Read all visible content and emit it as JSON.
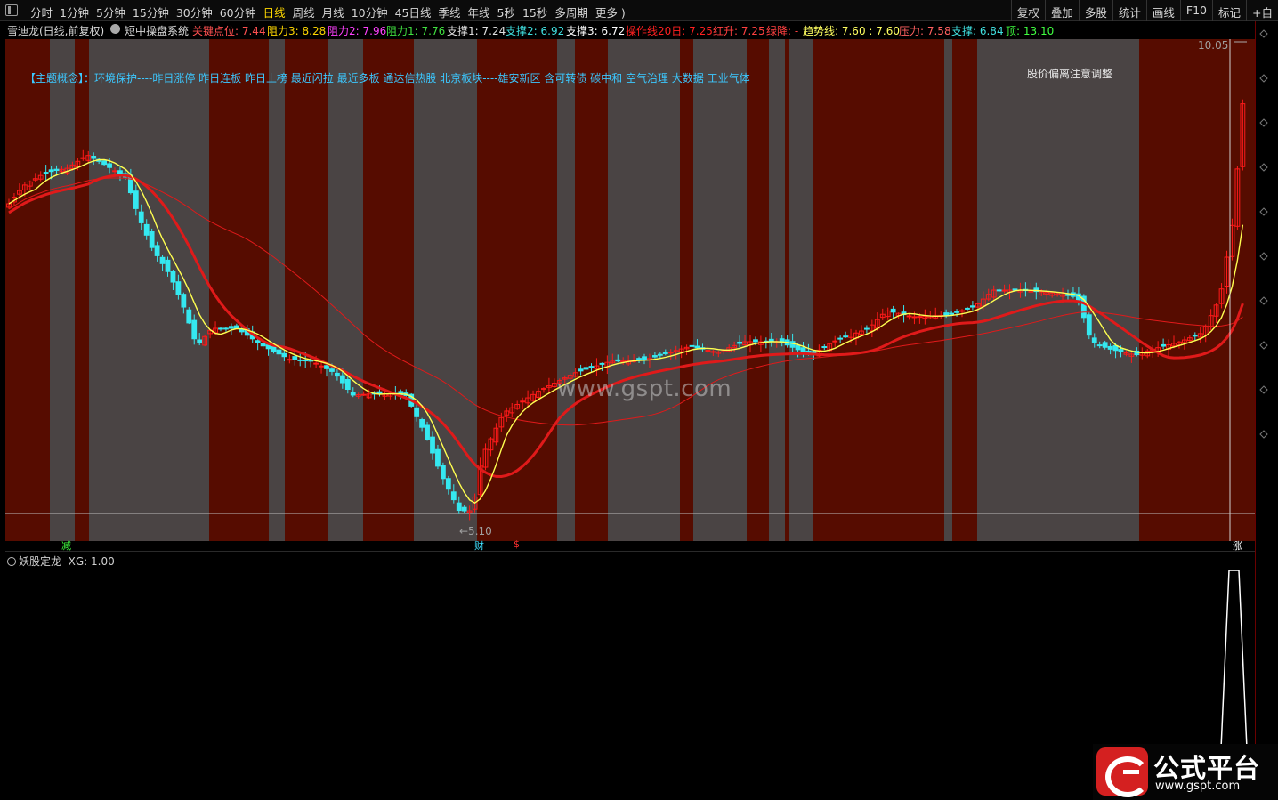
{
  "toolbar": {
    "periods": [
      "分时",
      "1分钟",
      "5分钟",
      "15分钟",
      "30分钟",
      "60分钟",
      "日线",
      "周线",
      "月线",
      "10分钟",
      "45日线",
      "季线",
      "年线",
      "5秒",
      "15秒",
      "多周期",
      "更多 )"
    ],
    "active_period": "日线",
    "right_tools": [
      "复权",
      "叠加",
      "多股",
      "统计",
      "画线",
      "F10",
      "标记",
      "+自"
    ]
  },
  "info_line": {
    "stock": "雪迪龙(日线,前复权)",
    "system": "短中操盘系统",
    "items": [
      {
        "label": "关键点位:",
        "value": "7.44",
        "color": "#ff5050"
      },
      {
        "label": "阻力3:",
        "value": "8.28",
        "color": "#ffd700"
      },
      {
        "label": "阻力2:",
        "value": "7.96",
        "color": "#ff40ff"
      },
      {
        "label": "阻力1:",
        "value": "7.76",
        "color": "#40e040"
      },
      {
        "label": "支撑1:",
        "value": "7.24",
        "color": "#e0e0e0"
      },
      {
        "label": "支撑2:",
        "value": "6.92",
        "color": "#40e0e0"
      },
      {
        "label": "支撑3:",
        "value": "6.72",
        "color": "#ffffff"
      },
      {
        "label": "操作线20日:",
        "value": "7.25",
        "color": "#ff2020"
      },
      {
        "label": "红升:",
        "value": "7.25",
        "color": "#ff4040"
      },
      {
        "label": "绿降:",
        "value": "-",
        "color": "#ff4040"
      },
      {
        "label": "趋势线:",
        "value": "7.60 : 7.60",
        "color": "#ffff60"
      },
      {
        "label": "压力:",
        "value": "7.58",
        "color": "#ff6060"
      },
      {
        "label": "支撑:",
        "value": "6.84",
        "color": "#40e0e0"
      },
      {
        "label": "顶:",
        "value": "13.10",
        "color": "#40ff40"
      }
    ]
  },
  "main": {
    "concept_text": "【主题概念】：环境保护----昨日涨停 昨日连板 昨日上榜 最近闪拉 最近多板 通达信热股 北京板块----雄安新区 含可转债 碳中和 空气治理 大数据 工业气体",
    "warning_text": "股价偏离注意调整",
    "watermark": "www.gspt.com",
    "price_high": "10.05",
    "price_low": "←5.10",
    "colors": {
      "up": "#ff1a1a",
      "down": "#35e8f0",
      "band_dark": "#560c00",
      "band_gray": "#4a4444",
      "ma_fast": "#ffff50",
      "ma_slow": "#e01a1a"
    }
  },
  "events": [
    {
      "label": "减",
      "color": "#40ff40"
    },
    {
      "label": "财",
      "color": "#40e0ff"
    },
    {
      "label": "$",
      "color": "#ff3030"
    },
    {
      "label": "涨",
      "color": "#ffffff"
    }
  ],
  "sub_panel": {
    "title": "妖股定龙",
    "indicator": "XG: 1.00"
  },
  "logo": {
    "name": "公式平台",
    "url": "www.gspt.com"
  }
}
